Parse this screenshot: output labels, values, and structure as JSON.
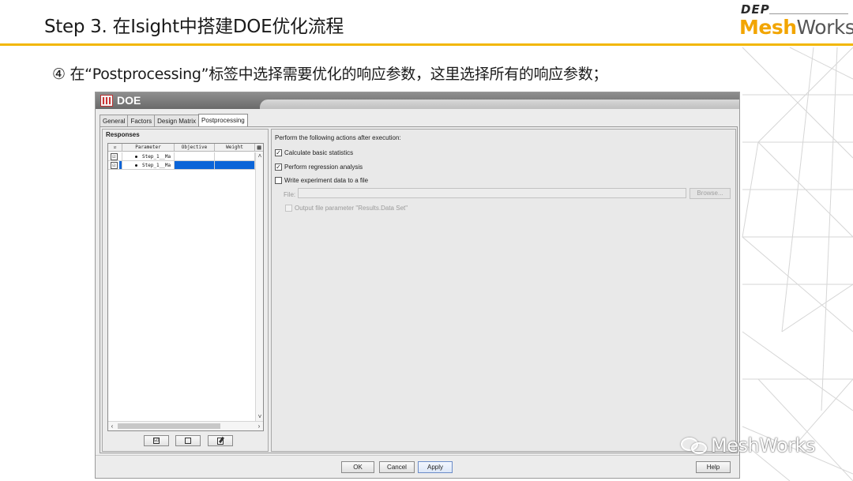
{
  "slide": {
    "title": "Step 3. 在Isight中搭建DOE优化流程",
    "instruction": "④ 在“Postprocessing”标签中选择需要优化的响应参数，这里选择所有的响应参数；",
    "logo_top": "DEP",
    "logo_mesh": "Mesh",
    "logo_works": "Works",
    "watermark": "MeshWorks",
    "accent_color": "#f2b705"
  },
  "window": {
    "title": "DOE",
    "tabs": [
      {
        "label": "General"
      },
      {
        "label": "Factors"
      },
      {
        "label": "Design Matrix"
      },
      {
        "label": "Postprocessing"
      }
    ],
    "active_tab": "Postprocessing"
  },
  "responses": {
    "label": "Responses",
    "columns": {
      "select": "☑",
      "parameter": "Parameter",
      "objective": "Objective",
      "weight": "Weight",
      "corner": "▦"
    },
    "rows": [
      {
        "checked": "☑",
        "parameter": "Step_1__Ma",
        "objective": "",
        "weight": ""
      },
      {
        "checked": "☑",
        "parameter": "Step_1__Ma",
        "objective": "",
        "weight": ""
      }
    ],
    "buttons": {
      "check_all": "☑",
      "uncheck_all": "☐",
      "edit": "edit-icon"
    },
    "scroll": {
      "up": "˄",
      "down": "˅",
      "left": "‹",
      "right": "›"
    }
  },
  "options": {
    "heading": "Perform the following actions after execution:",
    "calc_stats": {
      "label": "Calculate basic statistics",
      "checked": "✓"
    },
    "regression": {
      "label": "Perform regression analysis",
      "checked": "✓"
    },
    "write_file": {
      "label": "Write experiment data to a file",
      "checked": ""
    },
    "file_label": "File:",
    "file_value": "",
    "browse": "Browse...",
    "output_param": {
      "label": "Output file parameter \"Results.Data Set\"",
      "checked": ""
    }
  },
  "footer": {
    "ok": "OK",
    "cancel": "Cancel",
    "apply": "Apply",
    "help": "Help"
  }
}
